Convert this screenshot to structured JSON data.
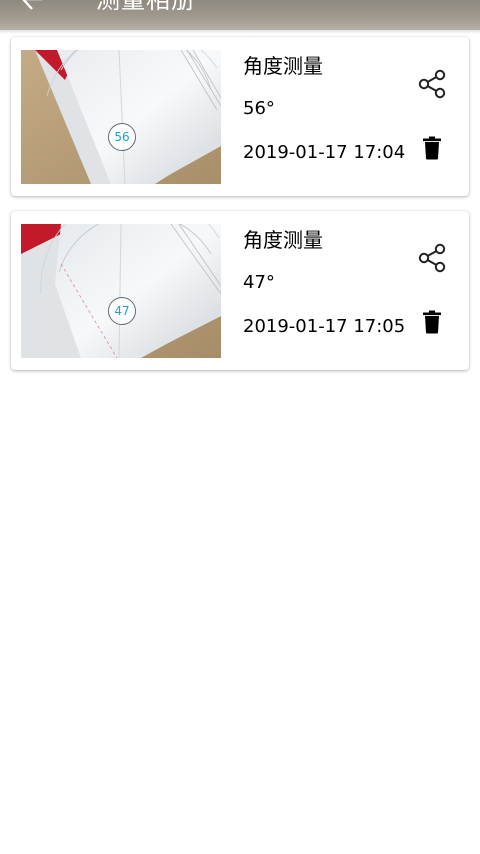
{
  "appbar": {
    "title": "测量相册",
    "back_icon": "back-arrow-icon"
  },
  "records": [
    {
      "title": "角度测量",
      "angle": "56°",
      "badge": "56",
      "datetime": "2019-01-17 17:04",
      "share_icon": "share-icon",
      "delete_icon": "trash-icon"
    },
    {
      "title": "角度测量",
      "angle": "47°",
      "badge": "47",
      "datetime": "2019-01-17 17:05",
      "share_icon": "share-icon",
      "delete_icon": "trash-icon"
    }
  ],
  "colors": {
    "badge_text": "#1aa3d6",
    "appbar": "#a09a8f"
  }
}
